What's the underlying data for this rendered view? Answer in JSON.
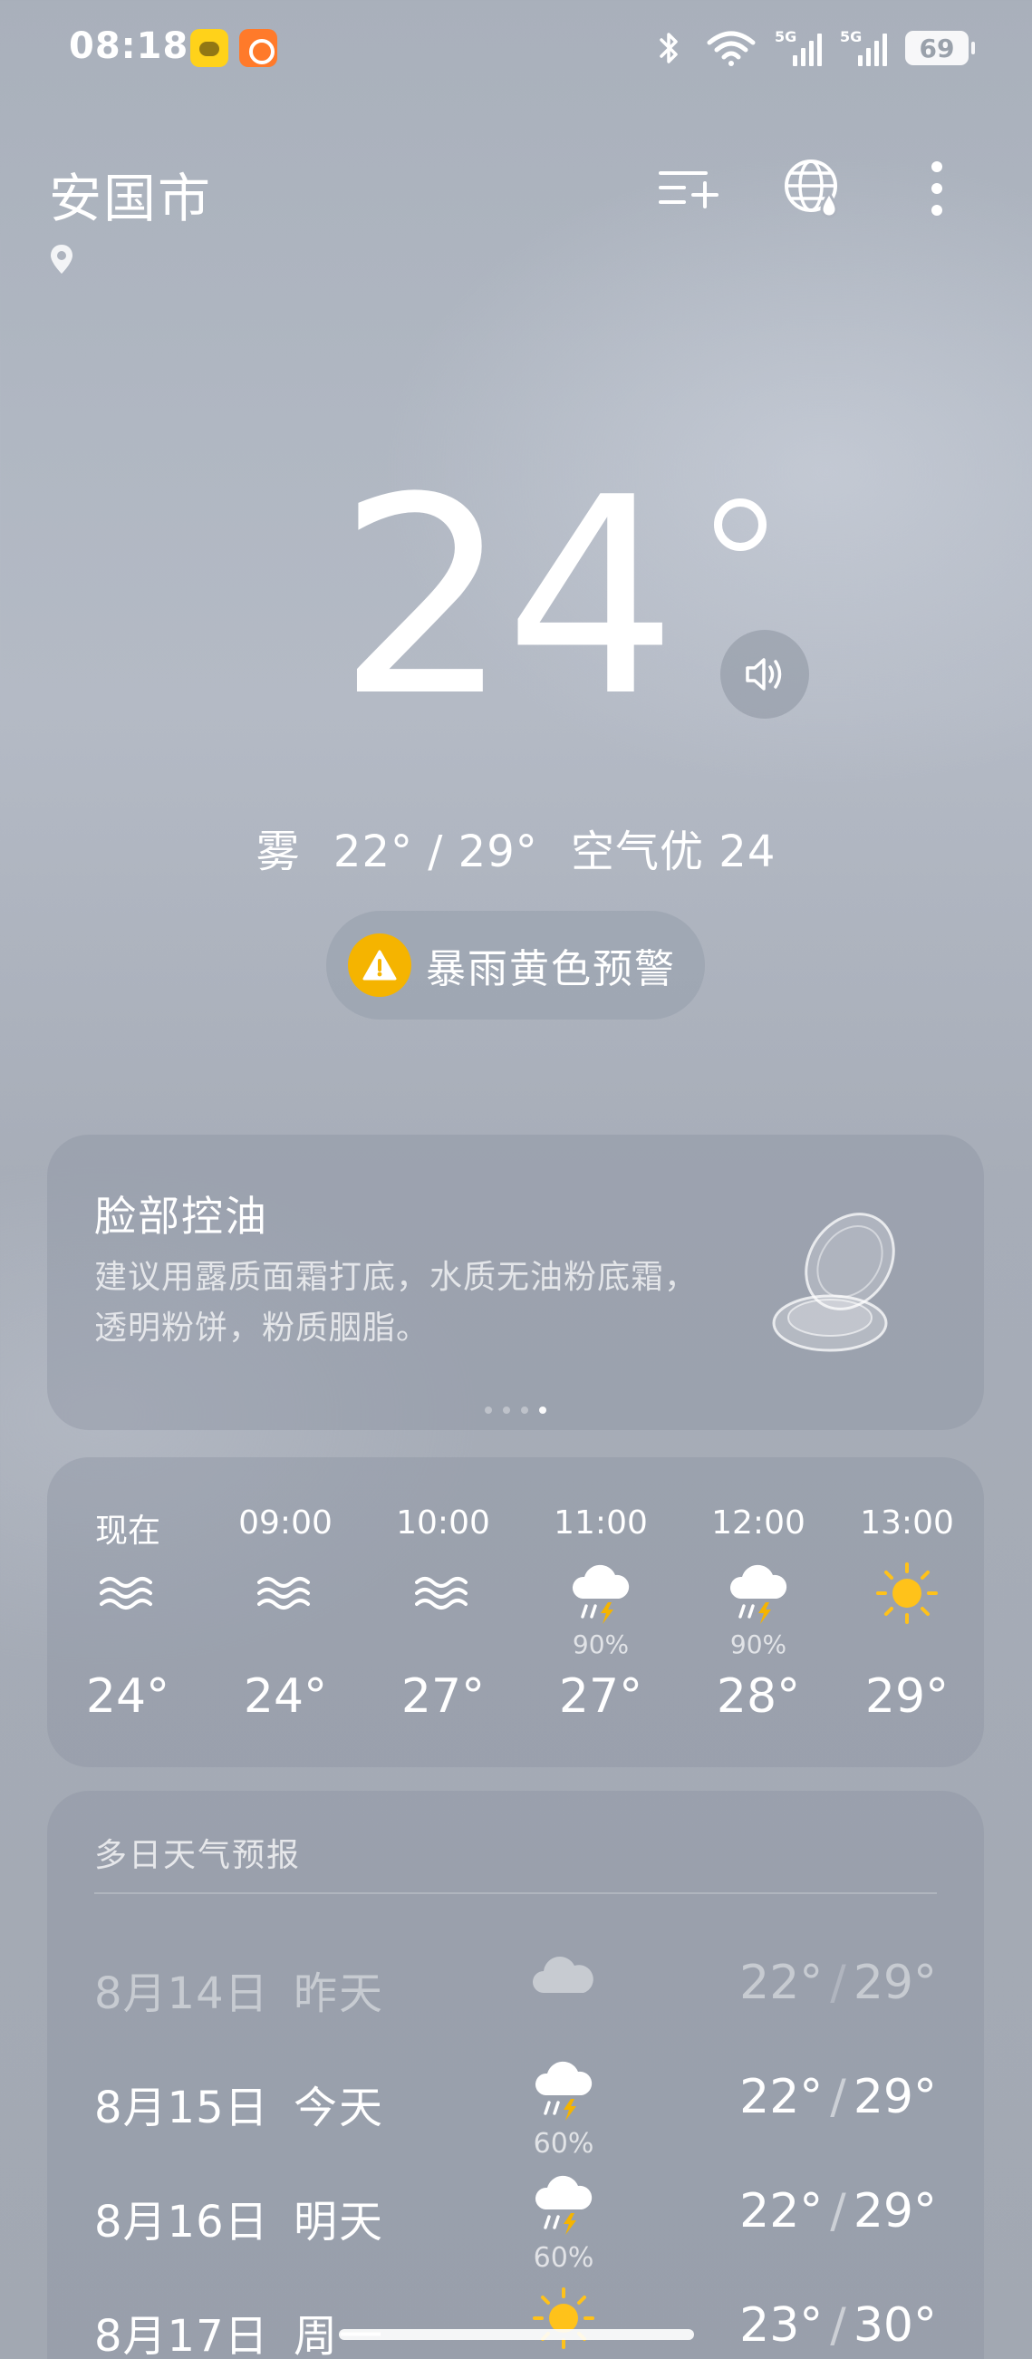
{
  "status_bar": {
    "time": "08:18",
    "network_1": "5G",
    "network_2": "5G",
    "battery": "69",
    "icons": [
      "app-badge-icon",
      "app-heart-icon",
      "bluetooth-icon",
      "wifi-icon",
      "signal-icon",
      "battery-icon"
    ]
  },
  "header": {
    "city": "安国市",
    "icons": [
      "location-pin-icon",
      "add-city-icon",
      "globe-rain-icon",
      "more-menu-icon"
    ]
  },
  "current": {
    "temperature": "24",
    "condition": "雾",
    "range": "22° / 29°",
    "air_quality": "空气优 24",
    "icons": [
      "speaker-icon"
    ]
  },
  "alert": {
    "text": "暴雨黄色预警",
    "color": "#f5b400",
    "icon": "warning-icon"
  },
  "tip": {
    "title": "脸部控油",
    "description": "建议用露质面霜打底，水质无油粉底霜，透明粉饼，粉质胭脂。",
    "icon": "compact-powder-icon",
    "page_count": 4,
    "active_page": 4
  },
  "hourly": [
    {
      "label": "现在",
      "icon": "fog-icon",
      "prob": "",
      "temp": "24°"
    },
    {
      "label": "09:00",
      "icon": "fog-icon",
      "prob": "",
      "temp": "24°"
    },
    {
      "label": "10:00",
      "icon": "fog-icon",
      "prob": "",
      "temp": "27°"
    },
    {
      "label": "11:00",
      "icon": "thunderstorm-icon",
      "prob": "90%",
      "temp": "27°"
    },
    {
      "label": "12:00",
      "icon": "thunderstorm-icon",
      "prob": "90%",
      "temp": "28°"
    },
    {
      "label": "13:00",
      "icon": "sun-icon",
      "prob": "",
      "temp": "29°"
    }
  ],
  "daily": {
    "title": "多日天气预报",
    "rows": [
      {
        "date": "8月14日",
        "name": "昨天",
        "icon": "cloud-icon",
        "prob": "",
        "low": "22°",
        "high": "29°",
        "past": true
      },
      {
        "date": "8月15日",
        "name": "今天",
        "icon": "thunderstorm-icon",
        "prob": "60%",
        "low": "22°",
        "high": "29°",
        "past": false
      },
      {
        "date": "8月16日",
        "name": "明天",
        "icon": "thunderstorm-icon",
        "prob": "60%",
        "low": "22°",
        "high": "29°",
        "past": false
      },
      {
        "date": "8月17日",
        "name": "周一",
        "icon": "sun-icon",
        "prob": "",
        "low": "23°",
        "high": "30°",
        "past": false
      }
    ]
  },
  "colors": {
    "sun": "#ffc21a",
    "bolt": "#f5b400",
    "alert": "#f5b400"
  }
}
